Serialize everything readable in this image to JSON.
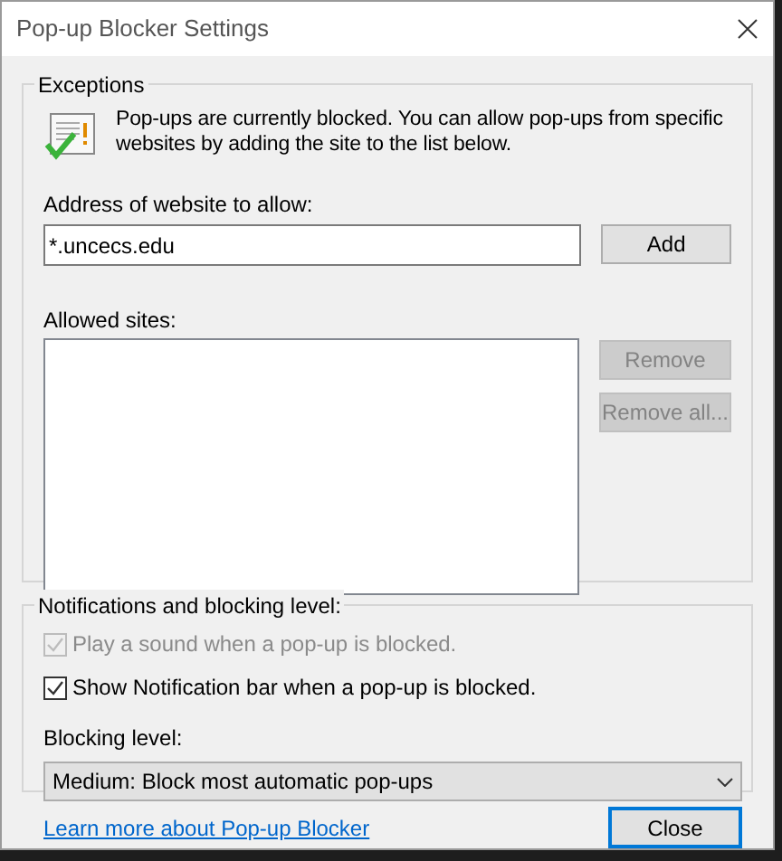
{
  "window": {
    "title": "Pop-up Blocker Settings"
  },
  "exceptions": {
    "legend": "Exceptions",
    "message": "Pop-ups are currently blocked.  You can allow pop-ups from specific websites by adding the site to the list below.",
    "address_label": "Address of website to allow:",
    "address_value": "*.uncecs.edu",
    "add_button": {
      "label": "Add",
      "disabled": false
    },
    "allowed_label": "Allowed sites:",
    "remove_buttons": [
      {
        "label": "Remove",
        "disabled": true
      },
      {
        "label": "Remove all...",
        "disabled": true
      }
    ]
  },
  "notifications": {
    "legend": "Notifications and blocking level:",
    "options": [
      {
        "label": "Play a sound when a pop-up is blocked.",
        "checked": true,
        "disabled": true
      },
      {
        "label": "Show Notification bar when a pop-up is blocked.",
        "checked": true,
        "disabled": false
      }
    ],
    "blocking_label": "Blocking level:",
    "blocking_value": "Medium: Block most automatic pop-ups"
  },
  "footer": {
    "link": "Learn more about Pop-up Blocker",
    "close_button": "Close"
  }
}
